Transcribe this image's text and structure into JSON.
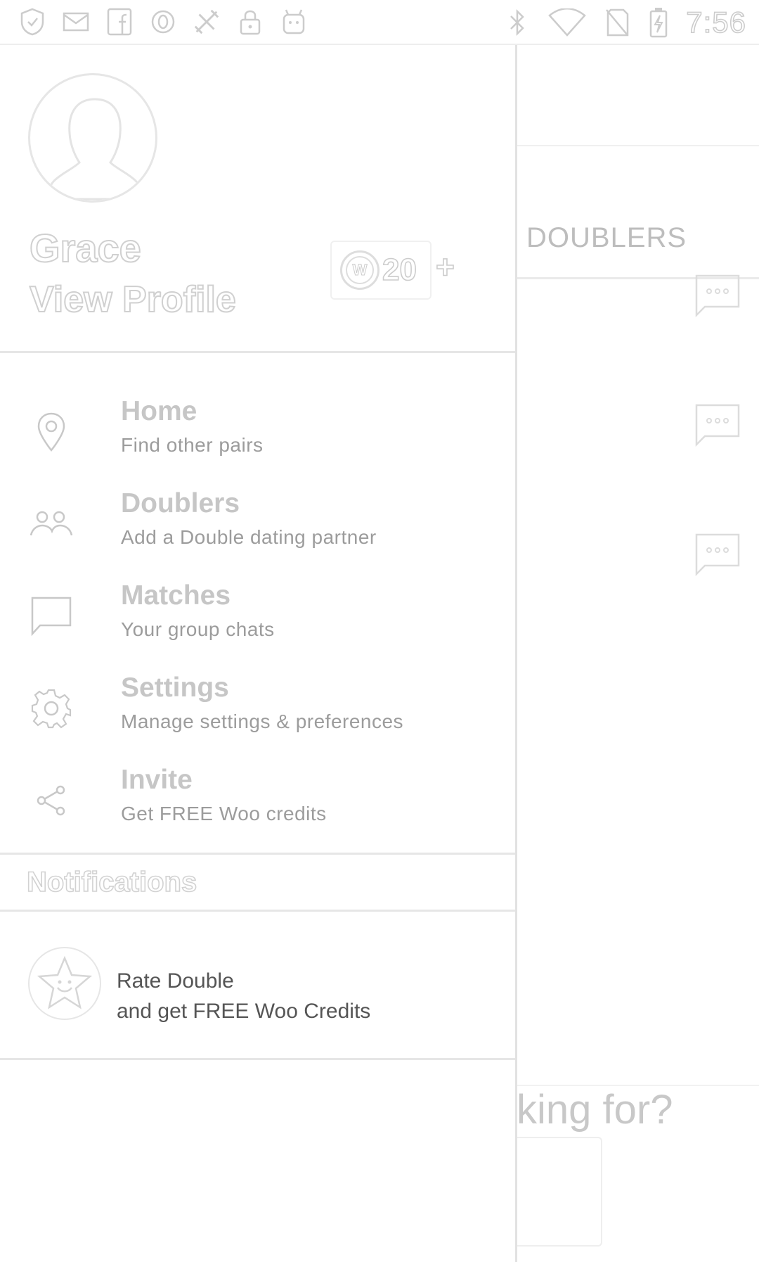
{
  "status_bar": {
    "time": "7:56",
    "left_icons": [
      "shield-icon",
      "mail-icon",
      "facebook-icon",
      "circle-o-icon",
      "tools-icon",
      "lock-icon",
      "android-icon"
    ],
    "right_icons": [
      "bluetooth-icon",
      "wifi-icon",
      "no-sim-icon",
      "battery-charging-icon"
    ]
  },
  "drawer": {
    "user": {
      "name": "Grace",
      "view_profile_label": "View Profile",
      "credits": "20",
      "add_credits_label": "+"
    },
    "menu": [
      {
        "title": "Home",
        "subtitle": "Find other pairs",
        "icon": "location-pin-icon"
      },
      {
        "title": "Doublers",
        "subtitle": "Add a Double dating partner",
        "icon": "people-icon"
      },
      {
        "title": "Matches",
        "subtitle": "Your group chats",
        "icon": "chat-icon"
      },
      {
        "title": "Settings",
        "subtitle": "Manage settings & preferences",
        "icon": "gear-icon"
      },
      {
        "title": "Invite",
        "subtitle": "Get FREE Woo credits",
        "icon": "share-icon"
      }
    ],
    "notifications_header": "Notifications",
    "notifications": [
      {
        "title": "Rate Double",
        "subtitle": "and get FREE Woo Credits",
        "icon": "star-face-icon"
      }
    ]
  },
  "background_screen": {
    "tab_label": "DOUBLERS",
    "partial_tab_char": "D",
    "prompt_text": "king for?",
    "colors": {
      "muted_text": "#bdbdbd",
      "divider": "#e6e6e6"
    }
  }
}
